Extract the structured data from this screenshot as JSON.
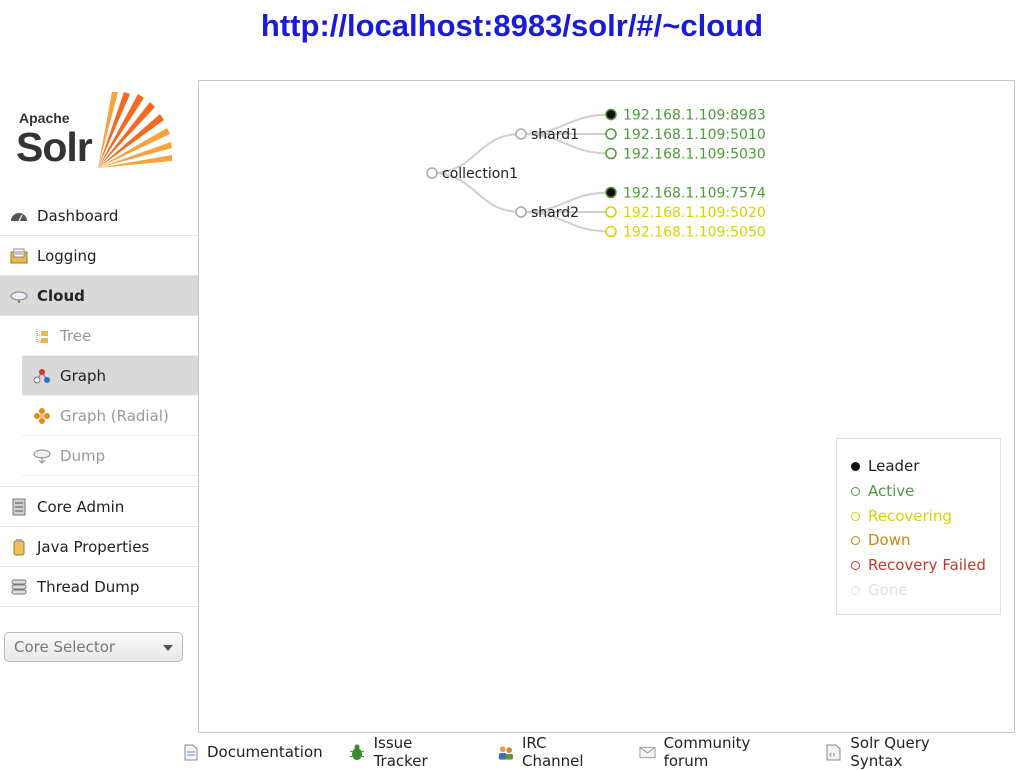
{
  "page_title": "http://localhost:8983/solr/#/~cloud",
  "logo": {
    "apache": "Apache",
    "solr": "Solr"
  },
  "nav": {
    "items": [
      {
        "label": "Dashboard",
        "icon": "dashboard-icon"
      },
      {
        "label": "Logging",
        "icon": "logging-icon"
      },
      {
        "label": "Cloud",
        "icon": "cloud-icon",
        "active": true
      }
    ],
    "cloud_sub": [
      {
        "label": "Tree",
        "icon": "tree-icon"
      },
      {
        "label": "Graph",
        "icon": "graph-icon",
        "active": true
      },
      {
        "label": "Graph (Radial)",
        "icon": "graph-radial-icon"
      },
      {
        "label": "Dump",
        "icon": "dump-icon"
      }
    ],
    "more": [
      {
        "label": "Core Admin",
        "icon": "core-admin-icon"
      },
      {
        "label": "Java Properties",
        "icon": "java-properties-icon"
      },
      {
        "label": "Thread Dump",
        "icon": "thread-dump-icon"
      }
    ]
  },
  "core_selector": {
    "label": "Core Selector"
  },
  "graph": {
    "collection": "collection1",
    "shards": [
      {
        "name": "shard1",
        "replicas": [
          {
            "address": "192.168.1.109:8983",
            "state": "leader-active"
          },
          {
            "address": "192.168.1.109:5010",
            "state": "active"
          },
          {
            "address": "192.168.1.109:5030",
            "state": "active"
          }
        ]
      },
      {
        "name": "shard2",
        "replicas": [
          {
            "address": "192.168.1.109:7574",
            "state": "leader-active"
          },
          {
            "address": "192.168.1.109:5020",
            "state": "recovering"
          },
          {
            "address": "192.168.1.109:5050",
            "state": "recovering"
          }
        ]
      }
    ]
  },
  "legend": {
    "leader": "Leader",
    "active": "Active",
    "recovering": "Recovering",
    "down": "Down",
    "recovery_failed": "Recovery Failed",
    "gone": "Gone"
  },
  "colors": {
    "active": "#4f9a3c",
    "recovering": "#d4d400",
    "down": "#c8870d",
    "recovery_failed": "#c0392b",
    "gone": "#e4e4e4",
    "link": "#1a1adc"
  },
  "footer": [
    {
      "label": "Documentation",
      "icon": "documentation-icon"
    },
    {
      "label": "Issue Tracker",
      "icon": "bug-icon"
    },
    {
      "label": "IRC Channel",
      "icon": "irc-icon"
    },
    {
      "label": "Community forum",
      "icon": "mail-icon"
    },
    {
      "label": "Solr Query Syntax",
      "icon": "query-syntax-icon"
    }
  ]
}
